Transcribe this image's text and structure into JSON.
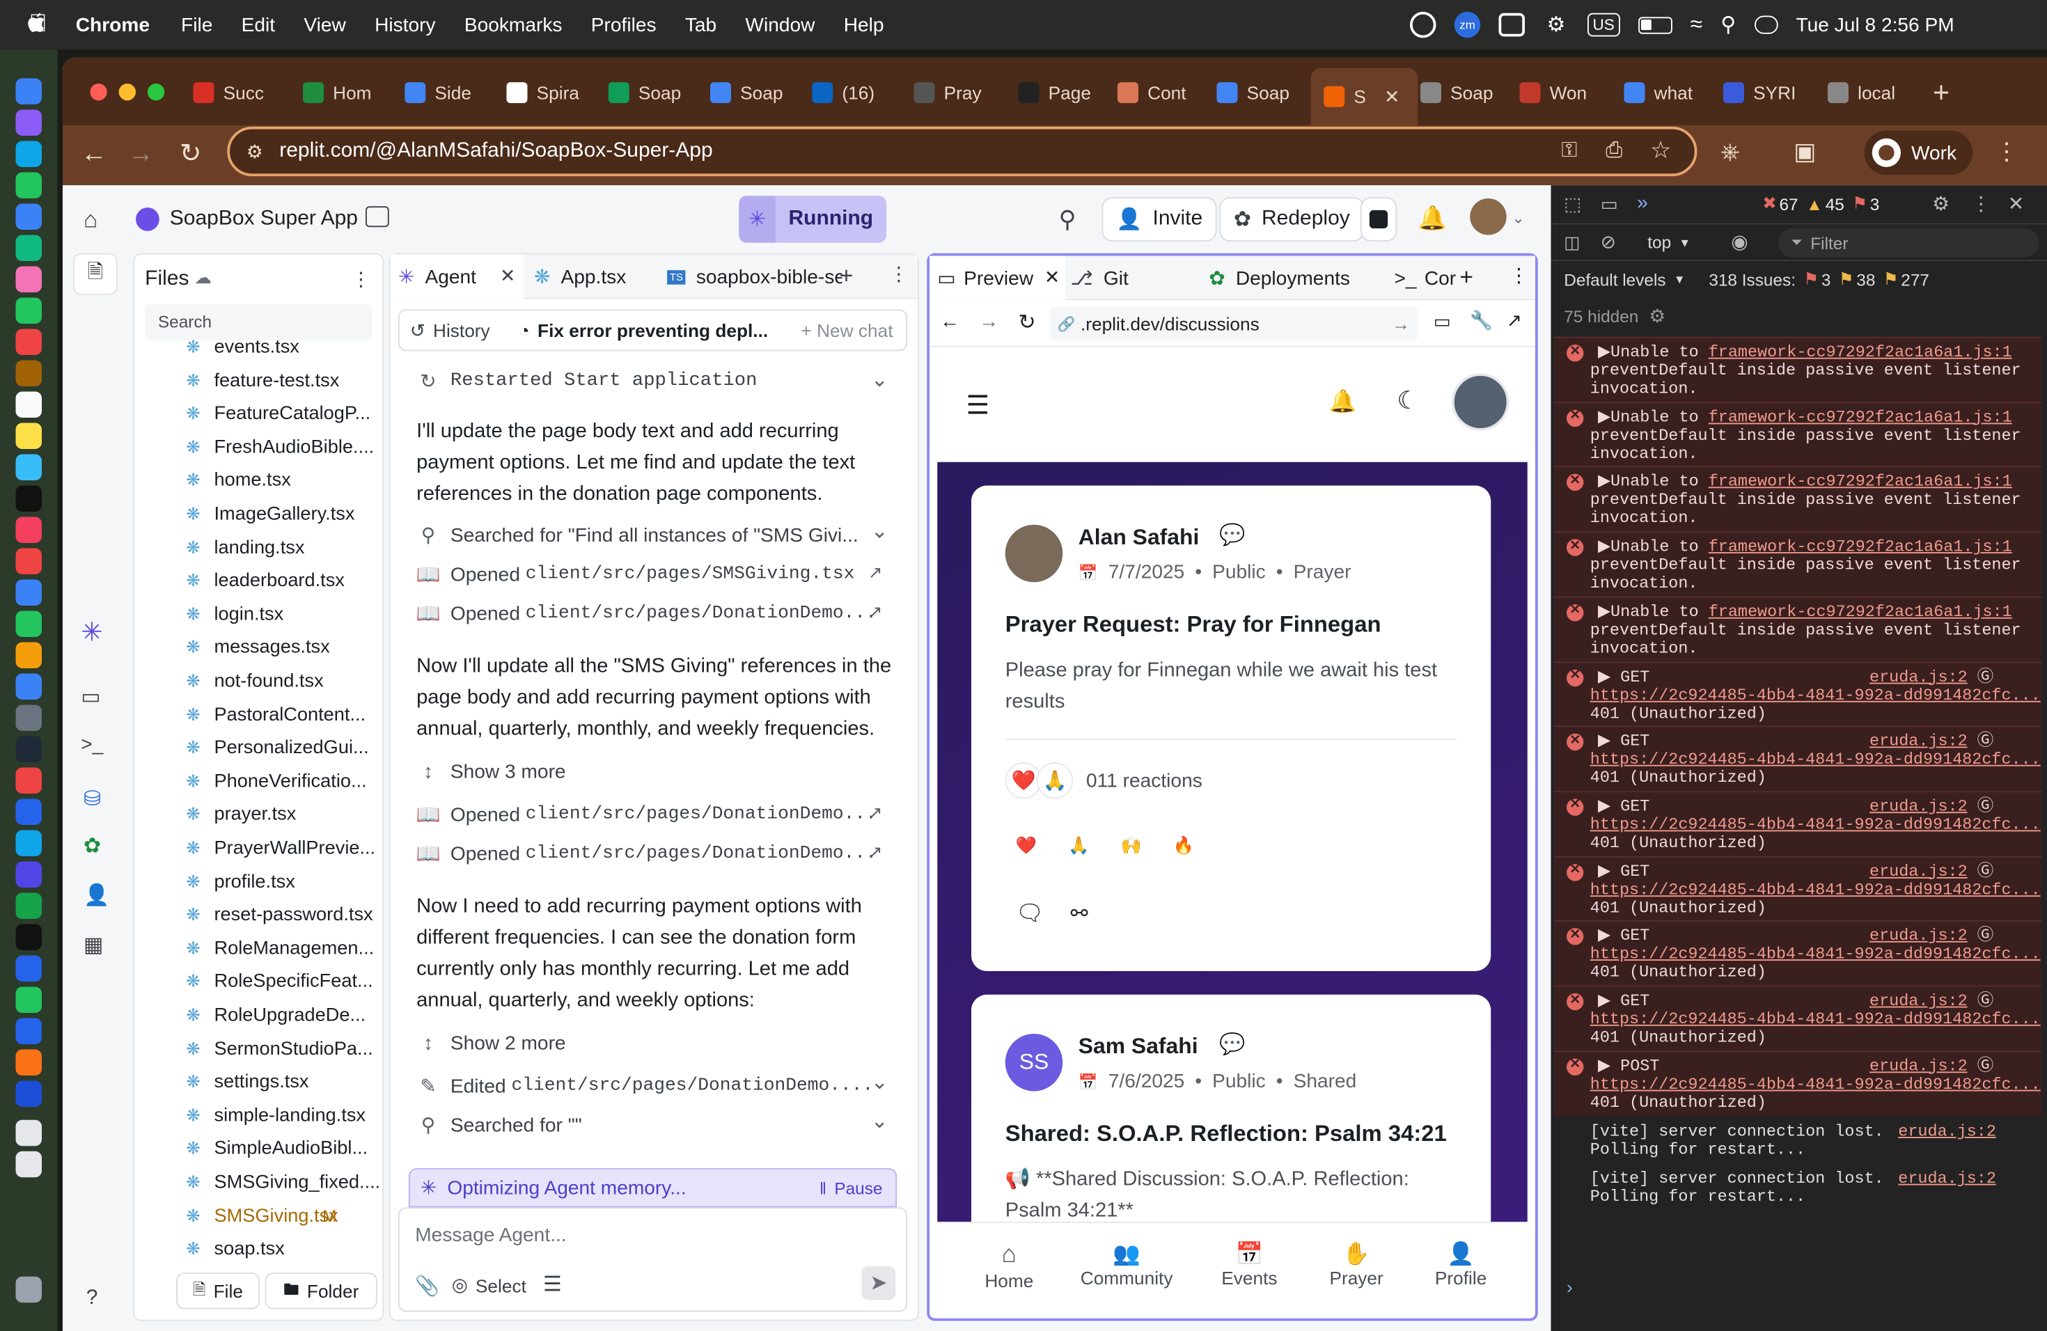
{
  "menubar": {
    "app_name": "Chrome",
    "items": [
      "File",
      "Edit",
      "View",
      "History",
      "Bookmarks",
      "Profiles",
      "Tab",
      "Window",
      "Help"
    ],
    "input_source": "US",
    "datetime": "Tue Jul 8  2:56 PM"
  },
  "browser": {
    "tabs": [
      {
        "label": "Succ",
        "icon": "gmail-icon",
        "color": "#d93025"
      },
      {
        "label": "Hom",
        "icon": "drive-icon",
        "color": "#1e8e3e"
      },
      {
        "label": "Side",
        "icon": "docs-icon",
        "color": "#4285f4"
      },
      {
        "label": "Spira",
        "icon": "spira-icon",
        "color": "#ffffff"
      },
      {
        "label": "Soap",
        "icon": "sheets-icon",
        "color": "#0f9d58"
      },
      {
        "label": "Soap",
        "icon": "docs-icon",
        "color": "#4285f4"
      },
      {
        "label": "(16)",
        "icon": "linkedin-icon",
        "color": "#0a66c2"
      },
      {
        "label": "Pray",
        "icon": "chatgpt-icon",
        "color": "#555555"
      },
      {
        "label": "Page",
        "icon": "github-icon",
        "color": "#222222"
      },
      {
        "label": "Cont",
        "icon": "claude-icon",
        "color": "#d97757"
      },
      {
        "label": "Soap",
        "icon": "docs-icon",
        "color": "#4285f4"
      },
      {
        "label": "S",
        "icon": "replit-icon",
        "color": "#f26207"
      },
      {
        "label": "Soap",
        "icon": "globe-icon",
        "color": "#888888"
      },
      {
        "label": "Won",
        "icon": "bookmark-icon",
        "color": "#c0392b"
      },
      {
        "label": "what",
        "icon": "google-icon",
        "color": "#4285f4"
      },
      {
        "label": "SYRI",
        "icon": "td-icon",
        "color": "#3b5bdb"
      },
      {
        "label": "local",
        "icon": "globe-icon",
        "color": "#888888"
      }
    ],
    "url": "replit.com/@AlanMSafahi/SoapBox-Super-App",
    "profile_label": "Work"
  },
  "replit": {
    "project_name": "SoapBox Super App",
    "run_status": "Running",
    "invite_label": "Invite",
    "redeploy_label": "Redeploy",
    "files": {
      "title": "Files",
      "search_placeholder": "Search",
      "items": [
        "events.tsx",
        "feature-test.tsx",
        "FeatureCatalogP...",
        "FreshAudioBible....",
        "home.tsx",
        "ImageGallery.tsx",
        "landing.tsx",
        "leaderboard.tsx",
        "login.tsx",
        "messages.tsx",
        "not-found.tsx",
        "PastoralContent...",
        "PersonalizedGui...",
        "PhoneVerificatio...",
        "prayer.tsx",
        "PrayerWallPrevie...",
        "profile.tsx",
        "reset-password.tsx",
        "RoleManagemen...",
        "RoleSpecificFeat...",
        "RoleUpgradeDe...",
        "SermonStudioPa...",
        "settings.tsx",
        "simple-landing.tsx",
        "SimpleAudioBibl...",
        "SMSGiving_fixed....",
        "SMSGiving.tsx",
        "soap.tsx"
      ],
      "modified_badge": "M",
      "new_file_label": "File",
      "new_folder_label": "Folder"
    },
    "editor_tabs": {
      "agent": "Agent",
      "app": "App.tsx",
      "bible": "soapbox-bible-se"
    },
    "agent": {
      "history_label": "History",
      "chat_title": "Fix error preventing depl...",
      "new_chat_label": "New chat",
      "restarted": "Restarted Start application",
      "msg1": "I'll update the page body text and add recurring payment options. Let me find and update the text references in the donation page components.",
      "searched1": "Searched for \"Find all instances of \"SMS Givi...",
      "opened1": "client/src/pages/SMSGiving.tsx",
      "opened2": "client/src/pages/DonationDemo...",
      "opened_prefix": "Opened",
      "msg2": "Now I'll update all the \"SMS Giving\" references in the page body and add recurring payment options with annual, quarterly, monthly, and weekly frequencies.",
      "show3": "Show 3 more",
      "opened3": "client/src/pages/DonationDemo...",
      "opened4": "client/src/pages/DonationDemo...",
      "msg3": "Now I need to add recurring payment options with different frequencies. I can see the donation form currently only has monthly recurring. Let me add annual, quarterly, and weekly options:",
      "show2": "Show 2 more",
      "edited_prefix": "Edited",
      "edited": "client/src/pages/DonationDemo....",
      "searched2": "Searched for \"\"",
      "status": "Optimizing Agent memory...",
      "pause_label": "Pause",
      "input_placeholder": "Message Agent...",
      "select_label": "Select"
    },
    "preview_tabs": {
      "preview": "Preview",
      "git": "Git",
      "deployments": "Deployments",
      "console": "Cor"
    },
    "preview_url": ".replit.dev/discussions",
    "posts": [
      {
        "author": "Alan Safahi",
        "date": "7/7/2025",
        "visibility": "Public",
        "category": "Prayer",
        "title": "Prayer Request: Pray for Finnegan",
        "body": "Please pray for Finnegan while we await his test results",
        "reactions": "011 reactions",
        "emoji_row": [
          "❤️",
          "🙏",
          "🙌",
          "🔥"
        ]
      },
      {
        "author": "Sam Safahi",
        "initials": "SS",
        "date": "7/6/2025",
        "visibility": "Public",
        "category": "Shared",
        "title": "Shared: S.O.A.P. Reflection: Psalm 34:21",
        "body": "📢 **Shared Discussion: S.O.A.P. Reflection: Psalm 34:21**"
      }
    ],
    "bottom_nav": [
      "Home",
      "Community",
      "Events",
      "Prayer",
      "Profile"
    ]
  },
  "devtools": {
    "errors_count": "67",
    "warnings_count": "45",
    "issues_badge": "3",
    "context": "top",
    "filter_placeholder": "Filter",
    "levels": "Default levels",
    "issues_label": "318 Issues:",
    "issues_err": "3",
    "issues_warn": "38",
    "issues_info": "277",
    "hidden": "75 hidden",
    "passive_link": "framework-cc97292f2ac1a6a1.js:1",
    "passive_text1": "Unable to",
    "passive_text2": "preventDefault inside passive event listener",
    "passive_text3": "invocation.",
    "net_link": "eruda.js:2",
    "net_url": "https://2c924485-4bb4-4841-992a-dd991482cfc...",
    "net_status": "401 (Unauthorized)",
    "net_methods": [
      "GET",
      "GET",
      "GET",
      "GET",
      "GET",
      "GET",
      "POST"
    ],
    "vite_text1": "[vite] server connection lost.",
    "vite_text2": "Polling for restart..."
  }
}
